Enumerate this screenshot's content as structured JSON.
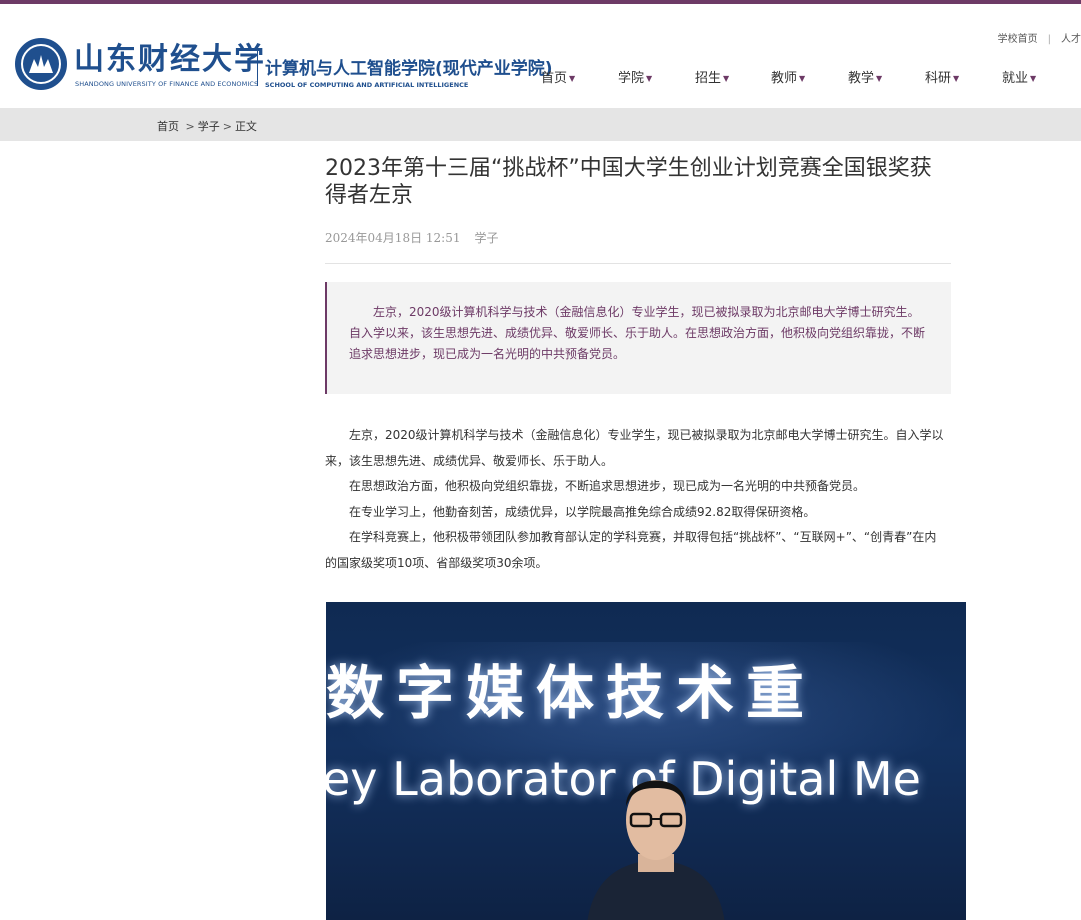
{
  "header": {
    "university_cn": "山东财经大学",
    "university_en": "SHANDONG UNIVERSITY OF FINANCE AND ECONOMICS",
    "school_cn": "计算机与人工智能学院(现代产业学院)",
    "school_en": "SCHOOL OF COMPUTING AND ARTIFICIAL INTELLIGENCE",
    "util_links": [
      "学校首页",
      "人才"
    ],
    "nav": [
      {
        "label": "首页"
      },
      {
        "label": "学院"
      },
      {
        "label": "招生"
      },
      {
        "label": "教师"
      },
      {
        "label": "教学"
      },
      {
        "label": "科研"
      },
      {
        "label": "就业"
      }
    ]
  },
  "breadcrumb": [
    "首页",
    "学子",
    "正文"
  ],
  "article": {
    "title": "2023年第十三届“挑战杯”中国大学生创业计划竞赛全国银奖获得者左京",
    "date": "2024年04月18日 12:51",
    "author": "学子",
    "summary": "左京，2020级计算机科学与技术（金融信息化）专业学生，现已被拟录取为北京邮电大学博士研究生。自入学以来，该生思想先进、成绩优异、敬爱师长、乐于助人。在思想政治方面，他积极向党组织靠拢，不断追求思想进步，现已成为一名光明的中共预备党员。",
    "paragraphs": [
      "左京，2020级计算机科学与技术（金融信息化）专业学生，现已被拟录取为北京邮电大学博士研究生。自入学以来，该生思想先进、成绩优异、敬爱师长、乐于助人。",
      "在思想政治方面，他积极向党组织靠拢，不断追求思想进步，现已成为一名光明的中共预备党员。",
      "在专业学习上，他勤奋刻苦，成绩优异，以学院最高推免综合成绩92.82取得保研资格。",
      "在学科竞赛上，他积极带领团队参加教育部认定的学科竞赛，并取得包括“挑战杯”、“互联网+”、“创青春”在内的国家级奖项10项、省部级奖项30余项。"
    ],
    "photo": {
      "sign_cn": "数字媒体技术重",
      "sign_en": "ey Laborator  of Digital Me"
    }
  },
  "colors": {
    "accent": "#6d3a66",
    "brand_blue": "#1f4f8e",
    "breadcrumb_bg": "#e5e5e5"
  }
}
